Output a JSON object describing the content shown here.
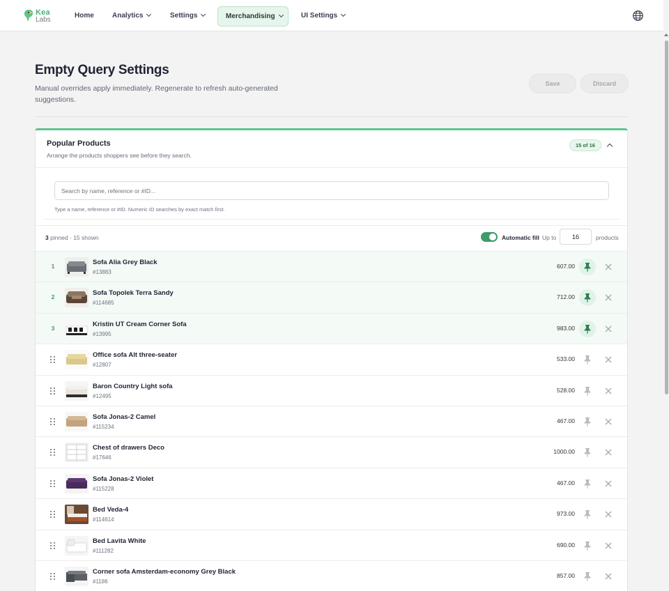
{
  "brand": {
    "name": "Kea",
    "sub": "Labs",
    "accent": "#3e9b6a"
  },
  "nav": [
    {
      "label": "Home",
      "has_chevron": false,
      "active": false
    },
    {
      "label": "Analytics",
      "has_chevron": true,
      "active": false
    },
    {
      "label": "Settings",
      "has_chevron": true,
      "active": false
    },
    {
      "label": "Merchandising",
      "has_chevron": true,
      "active": true
    },
    {
      "label": "UI Settings",
      "has_chevron": true,
      "active": false
    }
  ],
  "header": {
    "title": "Empty Query Settings",
    "description": "Manual overrides apply immediately. Regenerate to refresh auto-generated suggestions.",
    "save_label": "Save",
    "discard_label": "Discard"
  },
  "card": {
    "title": "Popular Products",
    "subtitle": "Arrange the products shoppers see before they search.",
    "count_badge": "15 of 16",
    "search_placeholder": "Search by name, reference or #ID...",
    "search_hint": "Type a name, reference or #ID. Numeric ID searches by exact match first.",
    "pinned_count": "3",
    "pinned_suffix": "pinned · 15 shown",
    "auto_fill_label": "Automatic fill",
    "auto_fill_on": true,
    "up_to_label": "Up to",
    "limit_value": "16",
    "products_label": "products"
  },
  "products": [
    {
      "index": "1",
      "pinned": true,
      "name": "Sofa Alia Grey Black",
      "id": "#13883",
      "price": "607.00",
      "thumb": "sofa-grey"
    },
    {
      "index": "2",
      "pinned": true,
      "name": "Sofa Topolek Terra Sandy",
      "id": "#114685",
      "price": "712.00",
      "thumb": "sofa-brown"
    },
    {
      "index": "3",
      "pinned": true,
      "name": "Kristin UT Cream Corner Sofa",
      "id": "#13995",
      "price": "983.00",
      "thumb": "sofa-corner"
    },
    {
      "index": "",
      "pinned": false,
      "name": "Office sofa Alt three-seater",
      "id": "#12807",
      "price": "533.00",
      "thumb": "sofa-yellow"
    },
    {
      "index": "",
      "pinned": false,
      "name": "Baron Country Light sofa",
      "id": "#12495",
      "price": "528.00",
      "thumb": "sofa-light"
    },
    {
      "index": "",
      "pinned": false,
      "name": "Sofa Jonas-2 Camel",
      "id": "#115234",
      "price": "467.00",
      "thumb": "sofa-camel"
    },
    {
      "index": "",
      "pinned": false,
      "name": "Chest of drawers Deco",
      "id": "#17646",
      "price": "1000.00",
      "thumb": "chest-white"
    },
    {
      "index": "",
      "pinned": false,
      "name": "Sofa Jonas-2 Violet",
      "id": "#115228",
      "price": "467.00",
      "thumb": "sofa-violet"
    },
    {
      "index": "",
      "pinned": false,
      "name": "Bed Veda-4",
      "id": "#114614",
      "price": "973.00",
      "thumb": "bed-room"
    },
    {
      "index": "",
      "pinned": false,
      "name": "Bed Lavita White",
      "id": "#111282",
      "price": "690.00",
      "thumb": "bed-white"
    },
    {
      "index": "",
      "pinned": false,
      "name": "Corner sofa Amsterdam-economy Grey Black",
      "id": "#1186",
      "price": "857.00",
      "thumb": "sofa-corner-grey"
    }
  ]
}
